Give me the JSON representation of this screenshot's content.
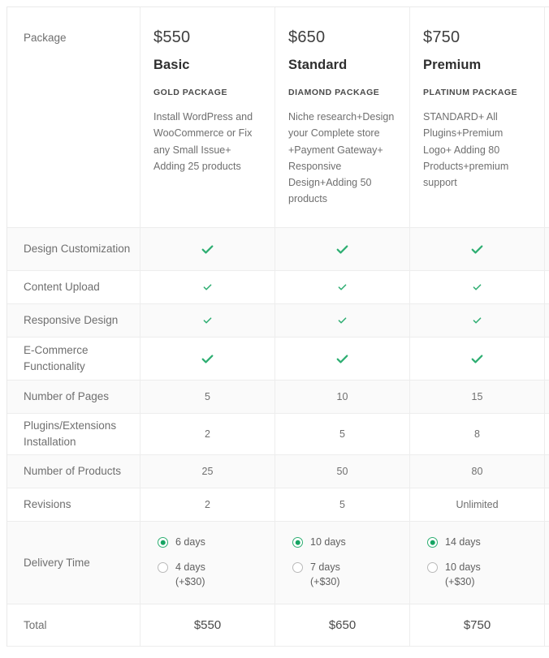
{
  "table": {
    "feature_header": "Package",
    "packages": [
      {
        "price": "$550",
        "name": "Basic",
        "tier": "GOLD PACKAGE",
        "description": "Install WordPress and WooCommerce or Fix any Small Issue+ Adding 25 products"
      },
      {
        "price": "$650",
        "name": "Standard",
        "tier": "DIAMOND PACKAGE",
        "description": "Niche research+Design your Complete store +Payment Gateway+ Responsive Design+Adding 50 products"
      },
      {
        "price": "$750",
        "name": "Premium",
        "tier": "PLATINUM PACKAGE",
        "description": "STANDARD+ All Plugins+Premium Logo+ Adding 80 Products+premium support"
      }
    ],
    "rows": [
      {
        "label": "Design Customization",
        "type": "check",
        "values": [
          "check",
          "check",
          "check"
        ]
      },
      {
        "label": "Content Upload",
        "type": "check",
        "values": [
          "check",
          "check",
          "check"
        ]
      },
      {
        "label": "Responsive Design",
        "type": "check",
        "values": [
          "check",
          "check",
          "check"
        ]
      },
      {
        "label": "E-Commerce Functionality",
        "type": "check",
        "values": [
          "check",
          "check",
          "check"
        ]
      },
      {
        "label": "Number of Pages",
        "type": "value",
        "values": [
          "5",
          "10",
          "15"
        ]
      },
      {
        "label": "Plugins/Extensions Installation",
        "type": "value",
        "values": [
          "2",
          "5",
          "8"
        ]
      },
      {
        "label": "Number of Products",
        "type": "value",
        "values": [
          "25",
          "50",
          "80"
        ]
      },
      {
        "label": "Revisions",
        "type": "value",
        "values": [
          "2",
          "5",
          "Unlimited"
        ]
      }
    ],
    "delivery": {
      "label": "Delivery Time",
      "columns": [
        {
          "options": [
            {
              "text": "6 days",
              "selected": true
            },
            {
              "text": "4 days (+$30)",
              "selected": false
            }
          ]
        },
        {
          "options": [
            {
              "text": "10 days",
              "selected": true
            },
            {
              "text": "7 days (+$30)",
              "selected": false
            }
          ]
        },
        {
          "options": [
            {
              "text": "14 days",
              "selected": true
            },
            {
              "text": "10 days (+$30)",
              "selected": false
            }
          ]
        }
      ]
    },
    "total": {
      "label": "Total",
      "values": [
        "$550",
        "$650",
        "$750"
      ]
    },
    "colors": {
      "accent_green": "#2eae72",
      "radio_fill": "#16a463",
      "text_muted": "#6f6f6f",
      "row_shaded": "#fafafa",
      "border": "#ededed"
    }
  }
}
